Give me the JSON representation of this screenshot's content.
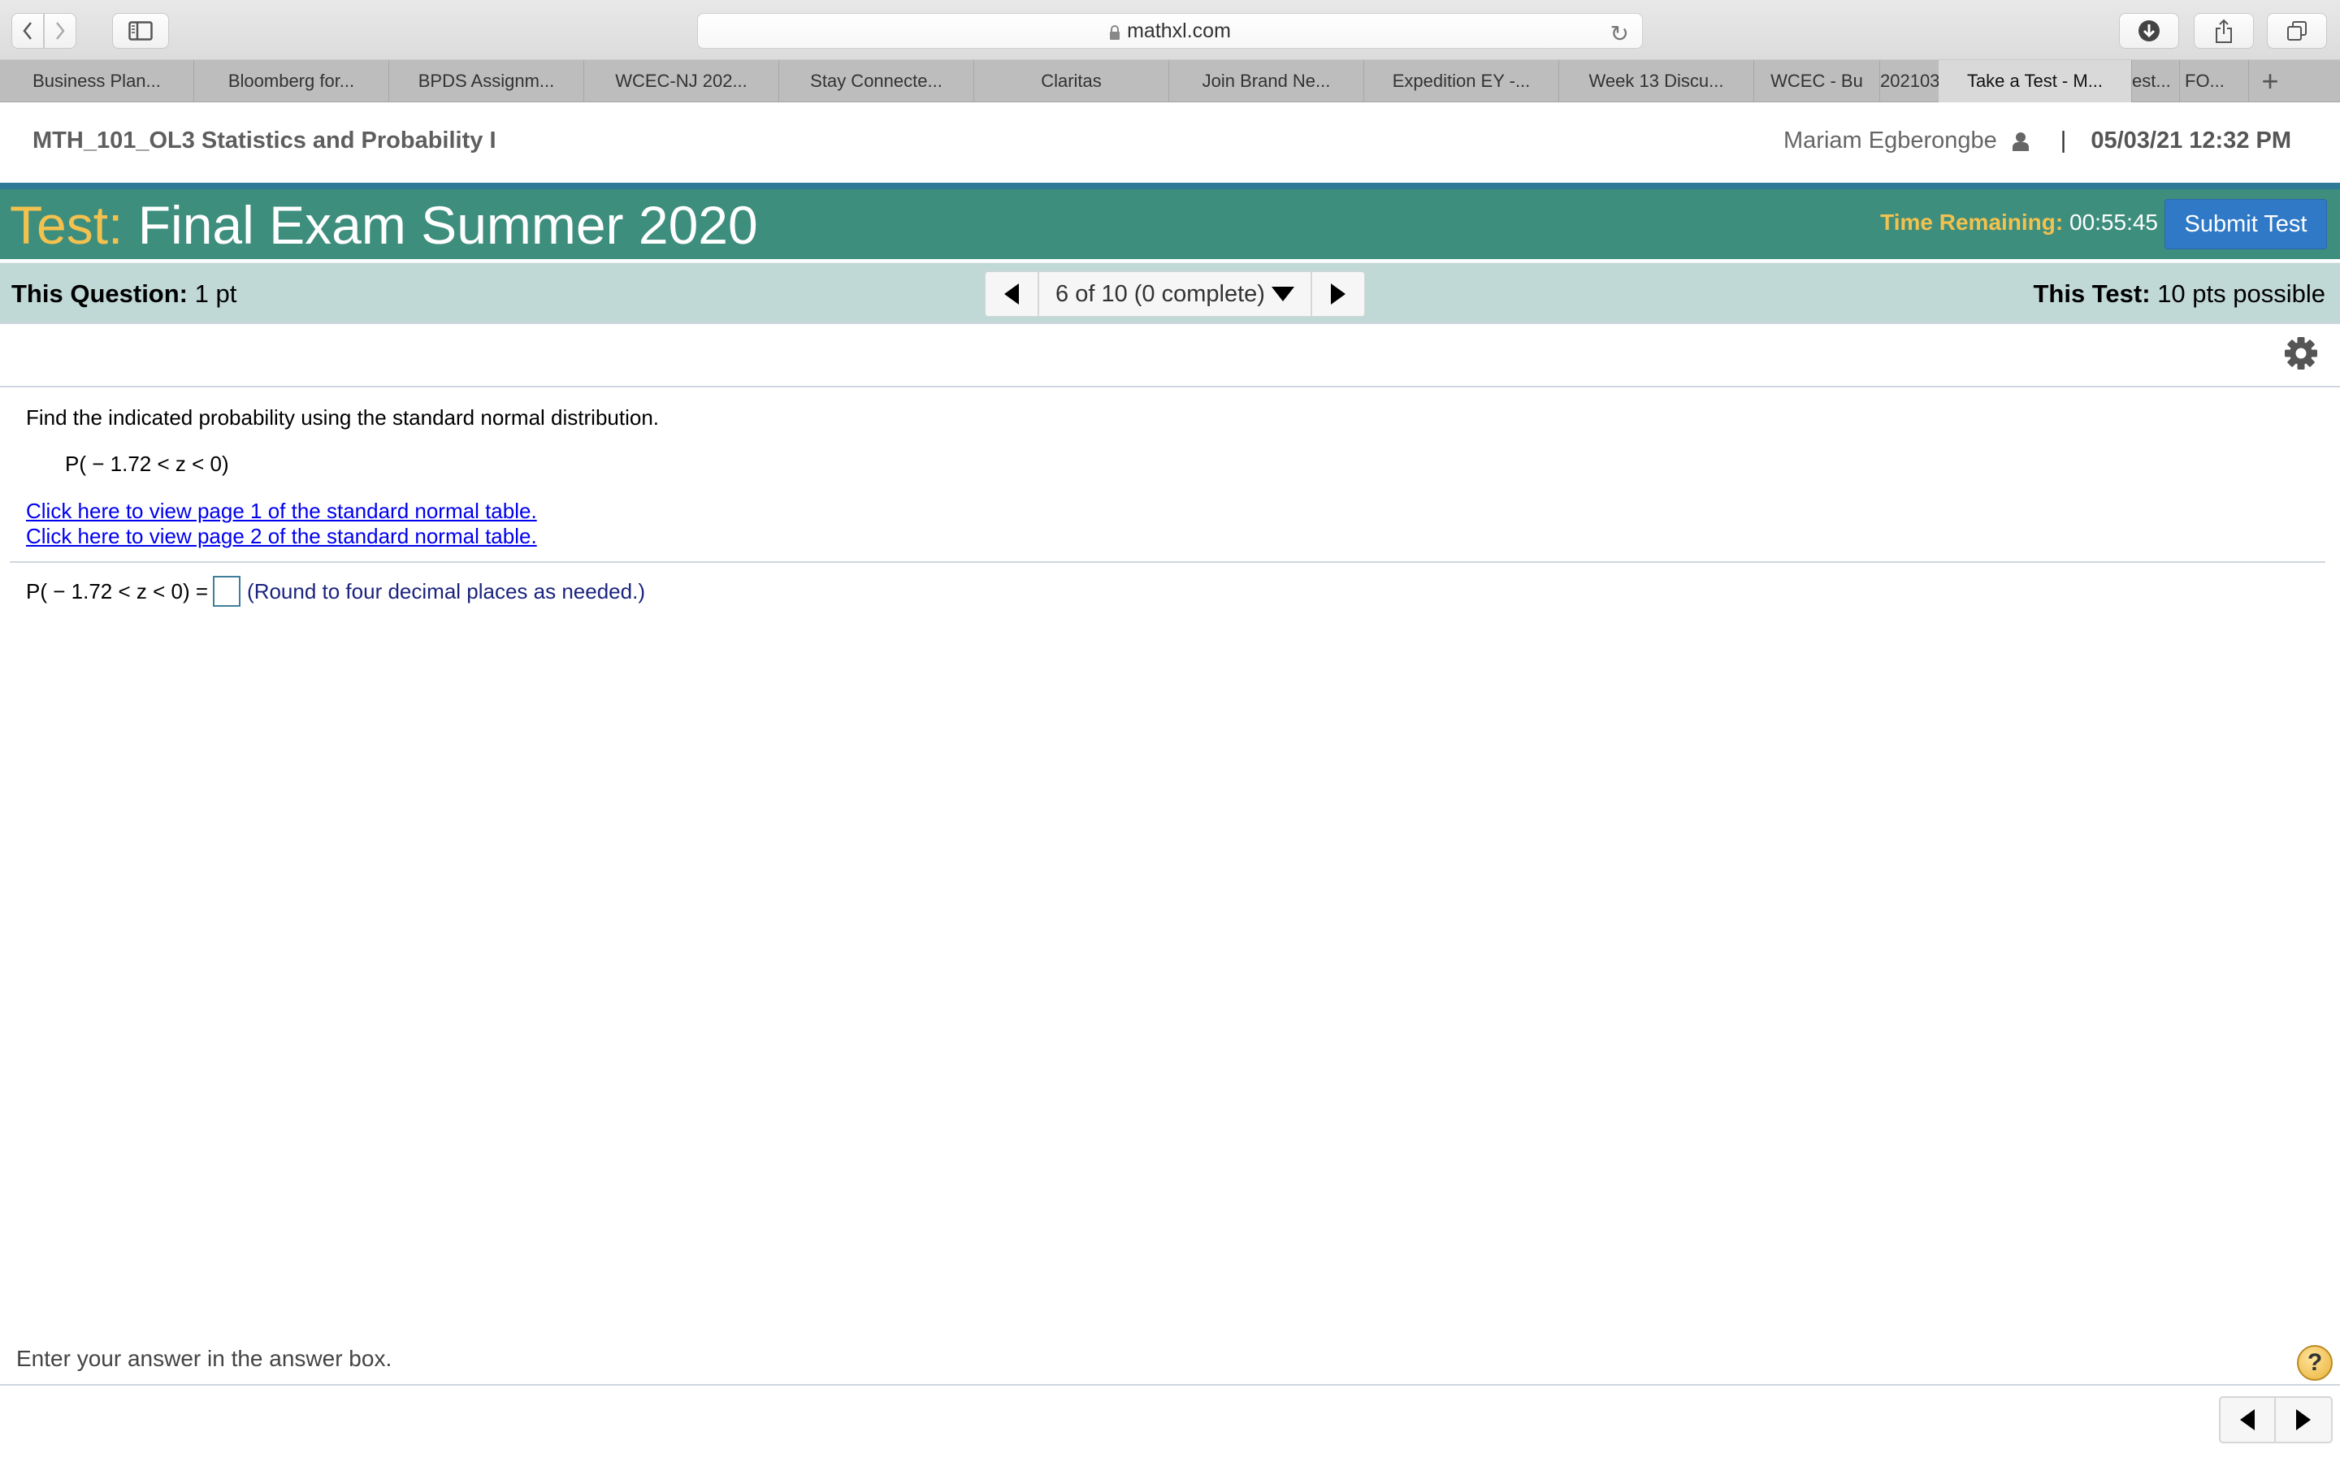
{
  "browser": {
    "url": "mathxl.com",
    "tabs": [
      {
        "label": "Business Plan...",
        "active": false
      },
      {
        "label": "Bloomberg for...",
        "active": false
      },
      {
        "label": "BPDS Assignm...",
        "active": false
      },
      {
        "label": "WCEC-NJ 202...",
        "active": false
      },
      {
        "label": "Stay Connecte...",
        "active": false
      },
      {
        "label": "Claritas",
        "active": false
      },
      {
        "label": "Join Brand Ne...",
        "active": false
      },
      {
        "label": "Expedition EY -...",
        "active": false
      },
      {
        "label": "Week 13 Discu...",
        "active": false
      },
      {
        "label": "WCEC - Bu",
        "active": false
      },
      {
        "label": "202103",
        "active": false
      },
      {
        "label": "Take a Test - M...",
        "active": true
      },
      {
        "label": "est...",
        "active": false
      },
      {
        "label": "FO...",
        "active": false
      }
    ],
    "new_tab_label": "+"
  },
  "header": {
    "course_title": "MTH_101_OL3 Statistics and Probability I",
    "user_name": "Mariam Egberongbe",
    "separator": "|",
    "datetime": "05/03/21 12:32 PM"
  },
  "banner": {
    "test_label": "Test:",
    "test_name": "Final Exam Summer 2020",
    "time_label": "Time Remaining:",
    "time_value": "00:55:45",
    "submit_label": "Submit Test",
    "colors": {
      "banner": "#3e8e7e",
      "accent": "#f3c14e",
      "submit": "#3079c6"
    }
  },
  "question_bar": {
    "question_label": "This Question:",
    "question_points": "1 pt",
    "nav_label": "6 of 10 (0 complete)",
    "test_label": "This Test:",
    "test_points": "10 pts possible"
  },
  "question": {
    "instruction": "Find the indicated probability using the standard normal distribution.",
    "expression": "P( − 1.72 < z < 0)",
    "links": [
      "Click here to view page 1 of the standard normal table.",
      "Click here to view page 2 of the standard normal table."
    ],
    "answer_prefix": "P( − 1.72 < z < 0) =",
    "answer_value": "",
    "answer_hint": "(Round to four decimal places as needed.)"
  },
  "footer": {
    "message": "Enter your answer in the answer box.",
    "help_label": "?"
  }
}
